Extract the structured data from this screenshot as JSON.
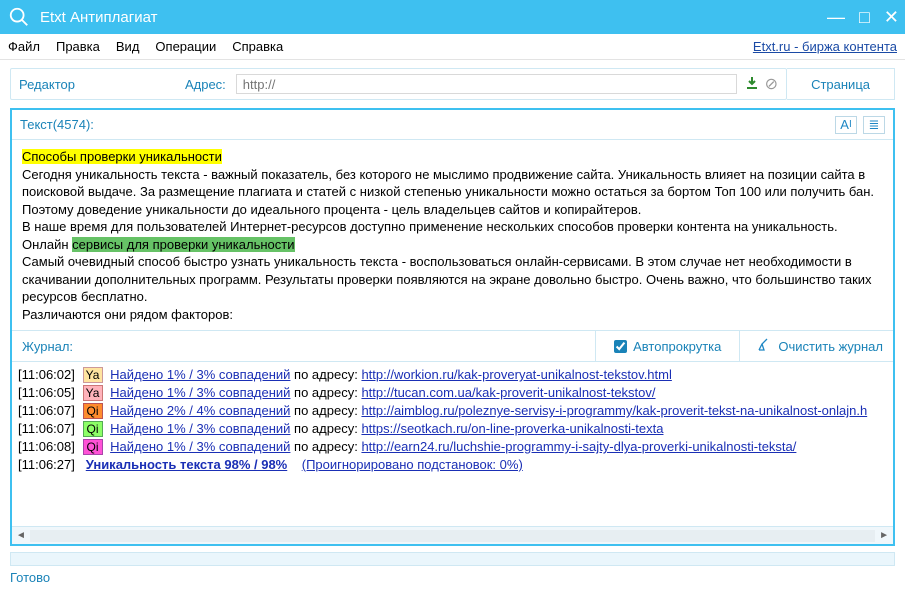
{
  "window": {
    "title": "Etxt Антиплагиат"
  },
  "menu": {
    "items": [
      "Файл",
      "Правка",
      "Вид",
      "Операции",
      "Справка"
    ],
    "etxt_link": "Etxt.ru - биржа контента"
  },
  "toolbar": {
    "editor_label": "Редактор",
    "address_label": "Адрес:",
    "address_placeholder": "http://",
    "tab_page": "Страница"
  },
  "text_panel": {
    "header": "Текст(4574):",
    "hl_methods": "Способы проверки уникальности",
    "p1": "Сегодня уникальность текста - важный показатель, без которого не мыслимо продвижение сайта. Уникальность влияет на позиции сайта в поисковой выдаче. За размещение плагиата и статей с низкой степенью уникальности можно остаться за бортом Топ 100 или получить бан. Поэтому доведение уникальности до идеального процента - цель владельцев сайтов и копирайтеров.",
    "p2": "В наше время для пользователей Интернет-ресурсов доступно применение нескольких способов проверки контента на уникальность.",
    "p3a": "Онлайн ",
    "hl_services": "сервисы для проверки уникальности",
    "p4": "Самый очевидный способ быстро узнать уникальность текста - воспользоваться онлайн-сервисами. В этом случае нет необходимости в скачивании дополнительных программ. Результаты проверки появляются на экране довольно быстро. Очень важно, что большинство таких ресурсов бесплатно.",
    "p5": "Различаются они рядом факторов:"
  },
  "journal": {
    "label": "Журнал:",
    "autoscroll": "Автопрокрутка",
    "clear": "Очистить журнал",
    "rows": [
      {
        "time": "[11:06:02]",
        "badge": "Ya",
        "bclass": "ya1",
        "match": "Найдено 1% / 3% совпадений",
        "by": " по адресу: ",
        "url": "http://workion.ru/kak-proveryat-unikalnost-tekstov.html"
      },
      {
        "time": "[11:06:05]",
        "badge": "Ya",
        "bclass": "ya2",
        "match": "Найдено 1% / 3% совпадений",
        "by": " по адресу: ",
        "url": "http://tucan.com.ua/kak-proverit-unikalnost-tekstov/"
      },
      {
        "time": "[11:06:07]",
        "badge": "Qi",
        "bclass": "qi1",
        "match": "Найдено 2% / 4% совпадений",
        "by": " по адресу: ",
        "url": "http://aimblog.ru/poleznye-servisy-i-programmy/kak-proverit-tekst-na-unikalnost-onlajn.h"
      },
      {
        "time": "[11:06:07]",
        "badge": "Qi",
        "bclass": "qi2",
        "match": "Найдено 1% / 3% совпадений",
        "by": " по адресу: ",
        "url": "https://seotkach.ru/on-line-proverka-unikalnosti-texta"
      },
      {
        "time": "[11:06:08]",
        "badge": "Qi",
        "bclass": "qi3",
        "match": "Найдено 1% / 3% совпадений",
        "by": " по адресу: ",
        "url": "http://earn24.ru/luchshie-programmy-i-sajty-dlya-proverki-unikalnosti-teksta/"
      }
    ],
    "final": {
      "time": "[11:06:27]",
      "result": "Уникальность текста 98% / 98%",
      "ignored": "(Проигнорировано подстановок: 0%)"
    }
  },
  "status": {
    "text": "Готово"
  }
}
